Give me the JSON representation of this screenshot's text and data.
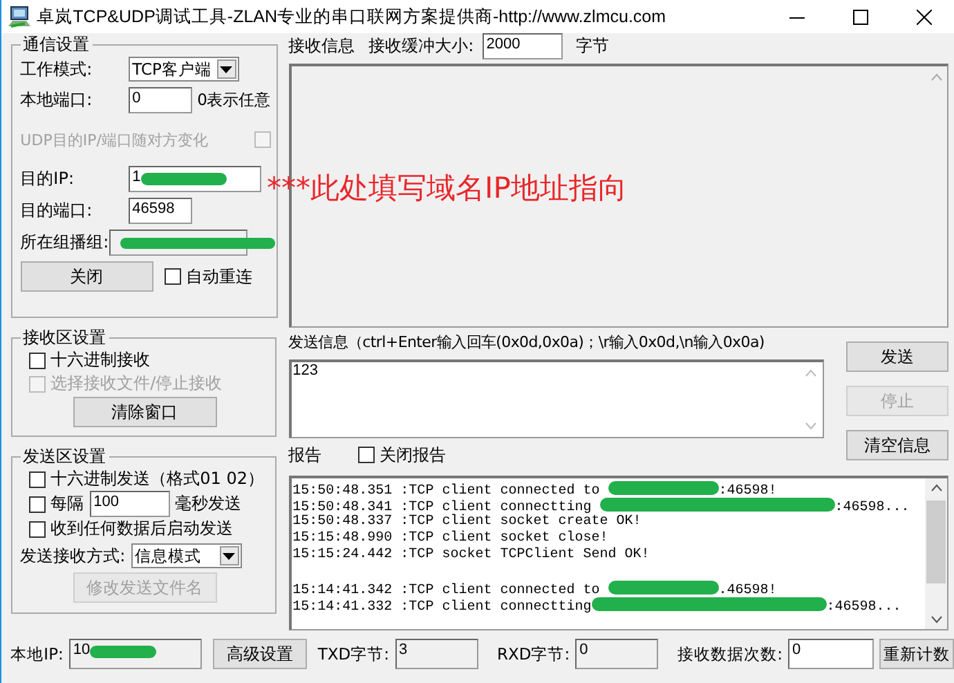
{
  "window": {
    "title": "卓岚TCP&UDP调试工具-ZLAN专业的串口联网方案提供商-http://www.zlmcu.com"
  },
  "comm_settings": {
    "title": "通信设置",
    "work_mode": {
      "label": "工作模式:",
      "value": "TCP客户端"
    },
    "local_port": {
      "label": "本地端口:",
      "value": "0",
      "hint": "0表示任意"
    },
    "udp_follow": {
      "label": "UDP目的IP/端口随对方变化",
      "checked": false,
      "disabled": true
    },
    "dest_ip": {
      "label": "目的IP:",
      "value": "1",
      "redacted": true
    },
    "dest_port": {
      "label": "目的端口:",
      "value": "46598"
    },
    "multicast": {
      "label": "所在组播组:",
      "redacted": true
    },
    "close_button": "关闭",
    "auto_reconnect": {
      "label": "自动重连",
      "checked": false
    }
  },
  "annotation": "***此处填写域名IP地址指向",
  "receive_settings": {
    "title": "接收区设置",
    "options": [
      {
        "label": "十六进制接收",
        "checked": false,
        "disabled": false
      },
      {
        "label": "选择接收文件/停止接收",
        "checked": false,
        "disabled": true
      }
    ],
    "clear_button": "清除窗口"
  },
  "send_settings": {
    "title": "发送区设置",
    "options": [
      {
        "kind": "check",
        "label": "十六进制发送（格式01 02）",
        "checked": false
      },
      {
        "kind": "interval",
        "label": "每隔",
        "value": "100",
        "unit": "毫秒发送",
        "checked": false
      },
      {
        "kind": "check",
        "label": "收到任何数据后启动发送",
        "checked": false
      }
    ],
    "mode": {
      "label": "发送接收方式:",
      "value": "信息模式"
    },
    "rename_button": {
      "label": "修改发送文件名",
      "disabled": true
    }
  },
  "receive": {
    "label": "接收信息",
    "buffer_label": "接收缓冲大小:",
    "buffer_value": "2000",
    "buffer_unit": "字节"
  },
  "send": {
    "label": "发送信息（ctrl+Enter输入回车(0x0d,0x0a)；\\r输入0x0d,\\n输入0x0a)",
    "value": "123",
    "buttons": [
      {
        "label": "发送",
        "disabled": false
      },
      {
        "label": "停止",
        "disabled": true
      },
      {
        "label": "清空信息",
        "disabled": false
      }
    ]
  },
  "report": {
    "label": "报告",
    "close_report": {
      "label": "关闭报告",
      "checked": false
    },
    "lines": [
      {
        "kind": "text",
        "before": "15:50:48.351 :TCP client connected to ",
        "redacted": true,
        "after": ":46598!"
      },
      {
        "kind": "text",
        "before": "15:50:48.341 :TCP client connectting ",
        "redacted": true,
        "after": ":46598..."
      },
      {
        "kind": "text",
        "before": "15:50:48.337 :TCP client socket create OK!",
        "redacted": false
      },
      {
        "kind": "text",
        "before": "15:15:48.990 :TCP client socket close!",
        "redacted": false
      },
      {
        "kind": "text",
        "before": "15:15:24.442 :TCP socket TCPClient Send OK!",
        "redacted": false
      },
      {
        "kind": "blank"
      },
      {
        "kind": "text",
        "before": "15:14:41.342 :TCP client connected to ",
        "redacted": true,
        "after": ".46598!"
      },
      {
        "kind": "text",
        "before": "15:14:41.332 :TCP client connectting",
        "redacted": true,
        "after": ":46598..."
      }
    ]
  },
  "status_bar": {
    "local_ip": {
      "label": "本地IP:",
      "value": "10",
      "redacted": true
    },
    "advanced_button": "高级设置",
    "txd": {
      "label": "TXD字节:",
      "value": "3"
    },
    "rxd": {
      "label": "RXD字节:",
      "value": "0"
    },
    "rx_count": {
      "label": "接收数据次数:",
      "value": "0"
    },
    "reset_button": "重新计数"
  }
}
